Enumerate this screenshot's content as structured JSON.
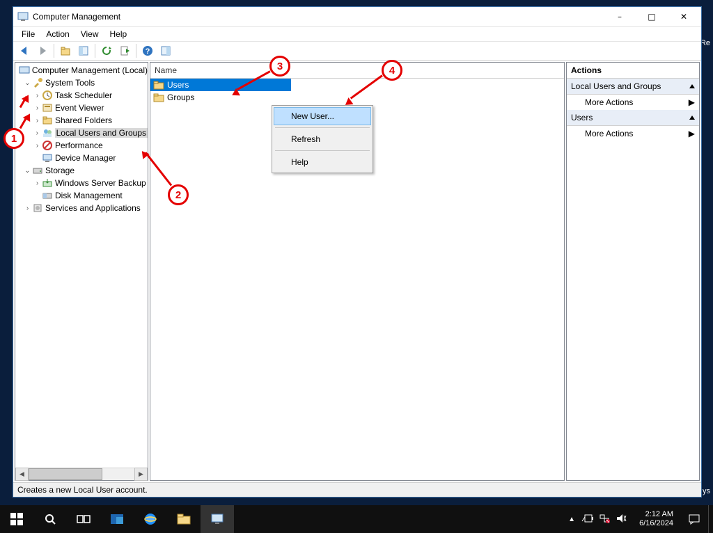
{
  "window": {
    "title": "Computer Management",
    "menus": [
      "File",
      "Action",
      "View",
      "Help"
    ]
  },
  "tree": {
    "root": "Computer Management (Local)",
    "system_tools": "System Tools",
    "task_scheduler": "Task Scheduler",
    "event_viewer": "Event Viewer",
    "shared_folders": "Shared Folders",
    "local_users": "Local Users and Groups",
    "performance": "Performance",
    "device_manager": "Device Manager",
    "storage": "Storage",
    "wsb": "Windows Server Backup",
    "disk_mgmt": "Disk Management",
    "services_apps": "Services and Applications"
  },
  "list": {
    "header": "Name",
    "users": "Users",
    "groups": "Groups"
  },
  "context_menu": {
    "new_user": "New User...",
    "refresh": "Refresh",
    "help": "Help"
  },
  "actions": {
    "title": "Actions",
    "group1": "Local Users and Groups",
    "more1": "More Actions",
    "group2": "Users",
    "more2": "More Actions"
  },
  "status": "Creates a new Local User account.",
  "annotations": {
    "n1": "1",
    "n2": "2",
    "n3": "3",
    "n4": "4"
  },
  "taskbar": {
    "time": "2:12 AM",
    "date": "6/16/2024"
  },
  "desktop_left": "Re",
  "desktop_right_line2": "ys"
}
